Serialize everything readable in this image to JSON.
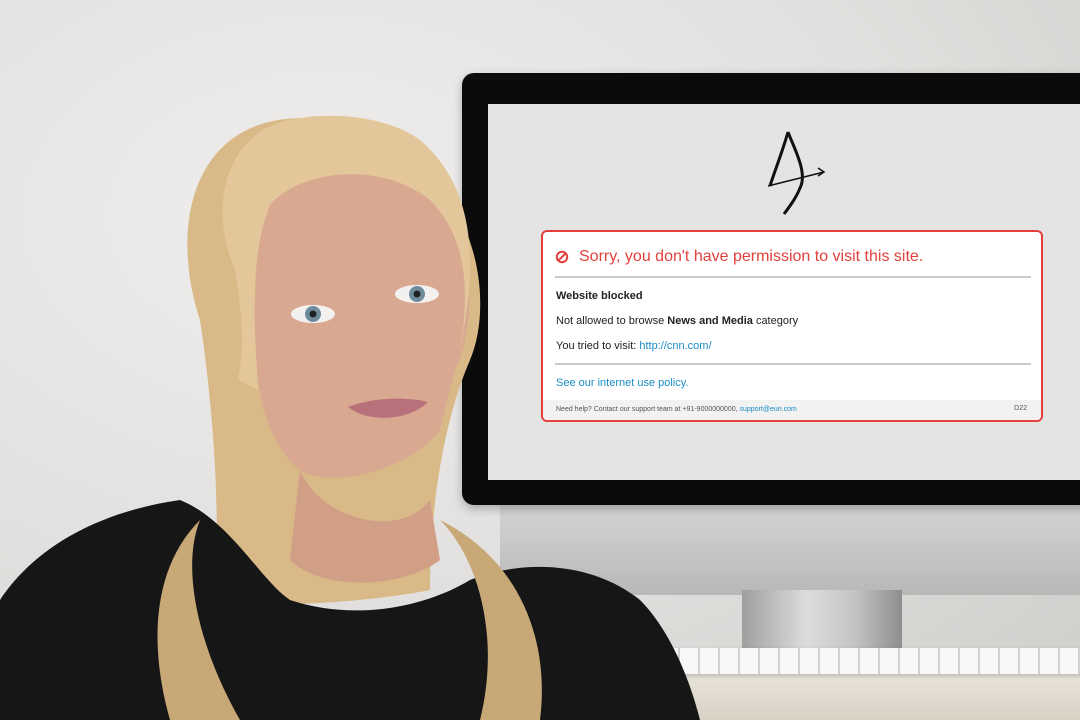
{
  "block_page": {
    "headline": "Sorry, you don't have permission to visit this site.",
    "status_title": "Website blocked",
    "category_prefix": "Not allowed to browse",
    "category_name": "News and Media",
    "category_suffix": "category",
    "tried_label": "You tried to visit:",
    "tried_url": "http://cnn.com/",
    "policy_link": "See our internet use policy.",
    "footer_text": "Need help? Contact our support team at +91-9000000000,",
    "footer_email": "support@eun.com",
    "footer_code": "D22",
    "icons": {
      "status": "ban-icon",
      "logo": "archer-bow-logo"
    }
  },
  "colors": {
    "alert_red": "#e2403b",
    "link_blue": "#1a8bc4"
  }
}
